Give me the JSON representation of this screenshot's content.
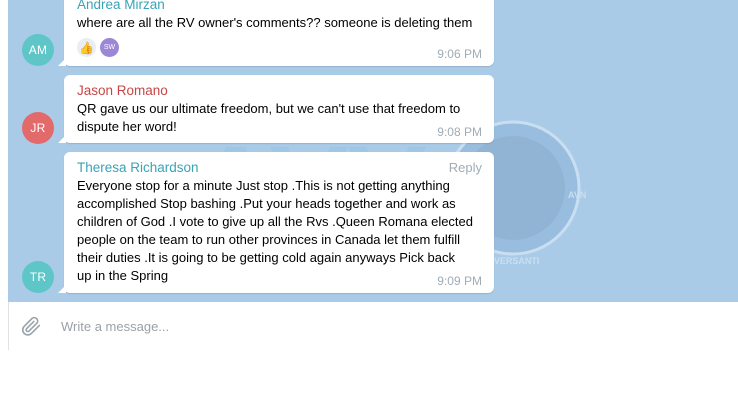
{
  "messages": [
    {
      "initials": "AM",
      "avatar_color": "#5fc6c8",
      "sender": "Andrea Mirzan",
      "sender_color": "#3aa3b7",
      "text": "where are all the RV owner's comments?? someone is deleting them",
      "reactions": {
        "emoji": "👍",
        "user_initials": "SW"
      },
      "time": "9:06 PM"
    },
    {
      "initials": "JR",
      "avatar_color": "#e26a6a",
      "sender": "Jason Romano",
      "sender_color": "#c94545",
      "text_lines": [
        "QR gave us our ultimate freedom, but we can't use that freedom to",
        "dispute her word!"
      ],
      "time": "9:08 PM"
    },
    {
      "initials": "TR",
      "avatar_color": "#5fc6c8",
      "sender": "Theresa Richardson",
      "sender_color": "#3aa3b7",
      "reply_label": "Reply",
      "text_lines": [
        "Everyone stop for a minute Just stop .This is not getting anything",
        "accomplished Stop bashing .Put your heads together and work as",
        "children of God .I vote to give up all the Rvs .Queen Romana elected",
        "people on the team to run other provinces in Canada let them fulfill",
        "their duties .It is going to be getting cold again anyways Pick back",
        "up in the Spring"
      ],
      "time": "9:09 PM"
    }
  ],
  "composer": {
    "placeholder": "Write a message..."
  },
  "watermark": {
    "text": "AVV",
    "badge_text": "AVN",
    "badge_caption": "AVERSANTI"
  }
}
